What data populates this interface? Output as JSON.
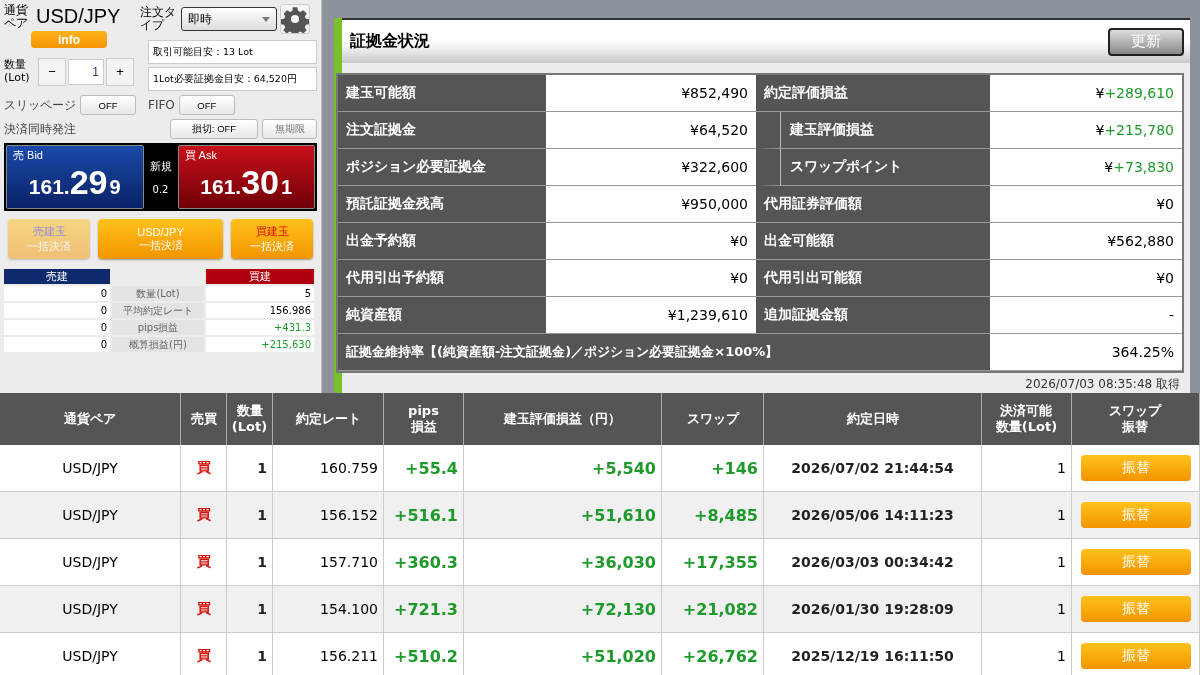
{
  "order_panel": {
    "pair_label": "通貨ペア",
    "pair": "USD/JPY",
    "info_button": "info",
    "order_type_label": "注文タイプ",
    "order_type": "即時",
    "available_lots": "取引可能目安：13 Lot",
    "margin_per_lot": "1Lot必要証拠金目安：64,520円",
    "quantity_label": "数量",
    "quantity_unit": "(Lot)",
    "quantity": "1",
    "minus": "−",
    "plus": "+",
    "slippage_label": "スリッページ",
    "slippage": "OFF",
    "fifo_label": "FIFO",
    "fifo": "OFF",
    "simultaneous_label": "決済同時発注",
    "stop_loss": "損切: OFF",
    "expiry": "無期限"
  },
  "quote": {
    "bid_label": "売 Bid",
    "bid_main": "161.",
    "bid_big": "29",
    "bid_small": "9",
    "spread_label": "新規",
    "spread": "0.2",
    "ask_label": "買 Ask",
    "ask_main": "161.",
    "ask_big": "30",
    "ask_small": "1"
  },
  "bulk_buttons": [
    {
      "kind": "sell",
      "line1": "売建玉",
      "line2": "一括決済",
      "disabled": true
    },
    {
      "kind": "pair",
      "line1": "USD/JPY",
      "line2": "一括決済",
      "disabled": false
    },
    {
      "kind": "buy",
      "line1": "買建玉",
      "line2": "一括決済",
      "disabled": false
    }
  ],
  "summary": {
    "sell_header": "売建",
    "buy_header": "買建",
    "rows": [
      {
        "sell": "0",
        "label": "数量(Lot)",
        "buy": "5",
        "gain": false
      },
      {
        "sell": "0",
        "label": "平均約定レート",
        "buy": "156.986",
        "gain": false
      },
      {
        "sell": "0",
        "label": "pips損益",
        "buy": "+431.3",
        "gain": true
      },
      {
        "sell": "0",
        "label": "概算損益(円)",
        "buy": "+215,630",
        "gain": true
      }
    ]
  },
  "margin_status": {
    "title": "証拠金状況",
    "refresh_button": "更新",
    "rows": [
      [
        {
          "label": "建玉可能額",
          "prefix": "¥",
          "value": "852,490",
          "gain": false,
          "indent": false
        },
        {
          "label": "約定評価損益",
          "prefix": "¥",
          "value": "+289,610",
          "gain": true,
          "indent": false
        }
      ],
      [
        {
          "label": "注文証拠金",
          "prefix": "¥",
          "value": "64,520",
          "gain": false,
          "indent": false
        },
        {
          "label": "建玉評価損益",
          "prefix": "¥",
          "value": "+215,780",
          "gain": true,
          "indent": true
        }
      ],
      [
        {
          "label": "ポジション必要証拠金",
          "prefix": "¥",
          "value": "322,600",
          "gain": false,
          "indent": false
        },
        {
          "label": "スワップポイント",
          "prefix": "¥",
          "value": "+73,830",
          "gain": true,
          "indent": true
        }
      ],
      [
        {
          "label": "預託証拠金残高",
          "prefix": "¥",
          "value": "950,000",
          "gain": false,
          "indent": false
        },
        {
          "label": "代用証券評価額",
          "prefix": "¥",
          "value": "0",
          "gain": false,
          "indent": false
        }
      ],
      [
        {
          "label": "出金予約額",
          "prefix": "¥",
          "value": "0",
          "gain": false,
          "indent": false
        },
        {
          "label": "出金可能額",
          "prefix": "¥",
          "value": "562,880",
          "gain": false,
          "indent": false
        }
      ],
      [
        {
          "label": "代用引出予約額",
          "prefix": "¥",
          "value": "0",
          "gain": false,
          "indent": false
        },
        {
          "label": "代用引出可能額",
          "prefix": "¥",
          "value": "0",
          "gain": false,
          "indent": false
        }
      ],
      [
        {
          "label": "純資産額",
          "prefix": "¥",
          "value": "1,239,610",
          "gain": false,
          "indent": false
        },
        {
          "label": "追加証拠金額",
          "value": "-",
          "gain": false,
          "indent": false
        }
      ]
    ],
    "ratio_label": "証拠金維持率【(純資産額-注文証拠金)／ポジション必要証拠金×100%】",
    "ratio": "364.25%",
    "timestamp": "2026/07/03 08:35:48 取得"
  },
  "positions": {
    "columns": [
      "通貨ペア",
      "売買",
      "数量\n(Lot)",
      "約定レート",
      "pips\n損益",
      "建玉評価損益（円）",
      "スワップ",
      "約定日時",
      "決済可能数量(Lot)",
      "スワップ振替"
    ],
    "rows": [
      {
        "pair": "USD/JPY",
        "side": "買",
        "qty": "1",
        "rate": "160.759",
        "pips": "+55.4",
        "pl": "+5,540",
        "swap": "+146",
        "date": "2026/07/02 21:44:54",
        "closable": "1",
        "action": "振替"
      },
      {
        "pair": "USD/JPY",
        "side": "買",
        "qty": "1",
        "rate": "156.152",
        "pips": "+516.1",
        "pl": "+51,610",
        "swap": "+8,485",
        "date": "2026/05/06 14:11:23",
        "closable": "1",
        "action": "振替"
      },
      {
        "pair": "USD/JPY",
        "side": "買",
        "qty": "1",
        "rate": "157.710",
        "pips": "+360.3",
        "pl": "+36,030",
        "swap": "+17,355",
        "date": "2026/03/03 00:34:42",
        "closable": "1",
        "action": "振替"
      },
      {
        "pair": "USD/JPY",
        "side": "買",
        "qty": "1",
        "rate": "154.100",
        "pips": "+721.3",
        "pl": "+72,130",
        "swap": "+21,082",
        "date": "2026/01/30 19:28:09",
        "closable": "1",
        "action": "振替"
      },
      {
        "pair": "USD/JPY",
        "side": "買",
        "qty": "1",
        "rate": "156.211",
        "pips": "+510.2",
        "pl": "+51,020",
        "swap": "+26,762",
        "date": "2025/12/19 16:11:50",
        "closable": "1",
        "action": "振替"
      }
    ]
  }
}
